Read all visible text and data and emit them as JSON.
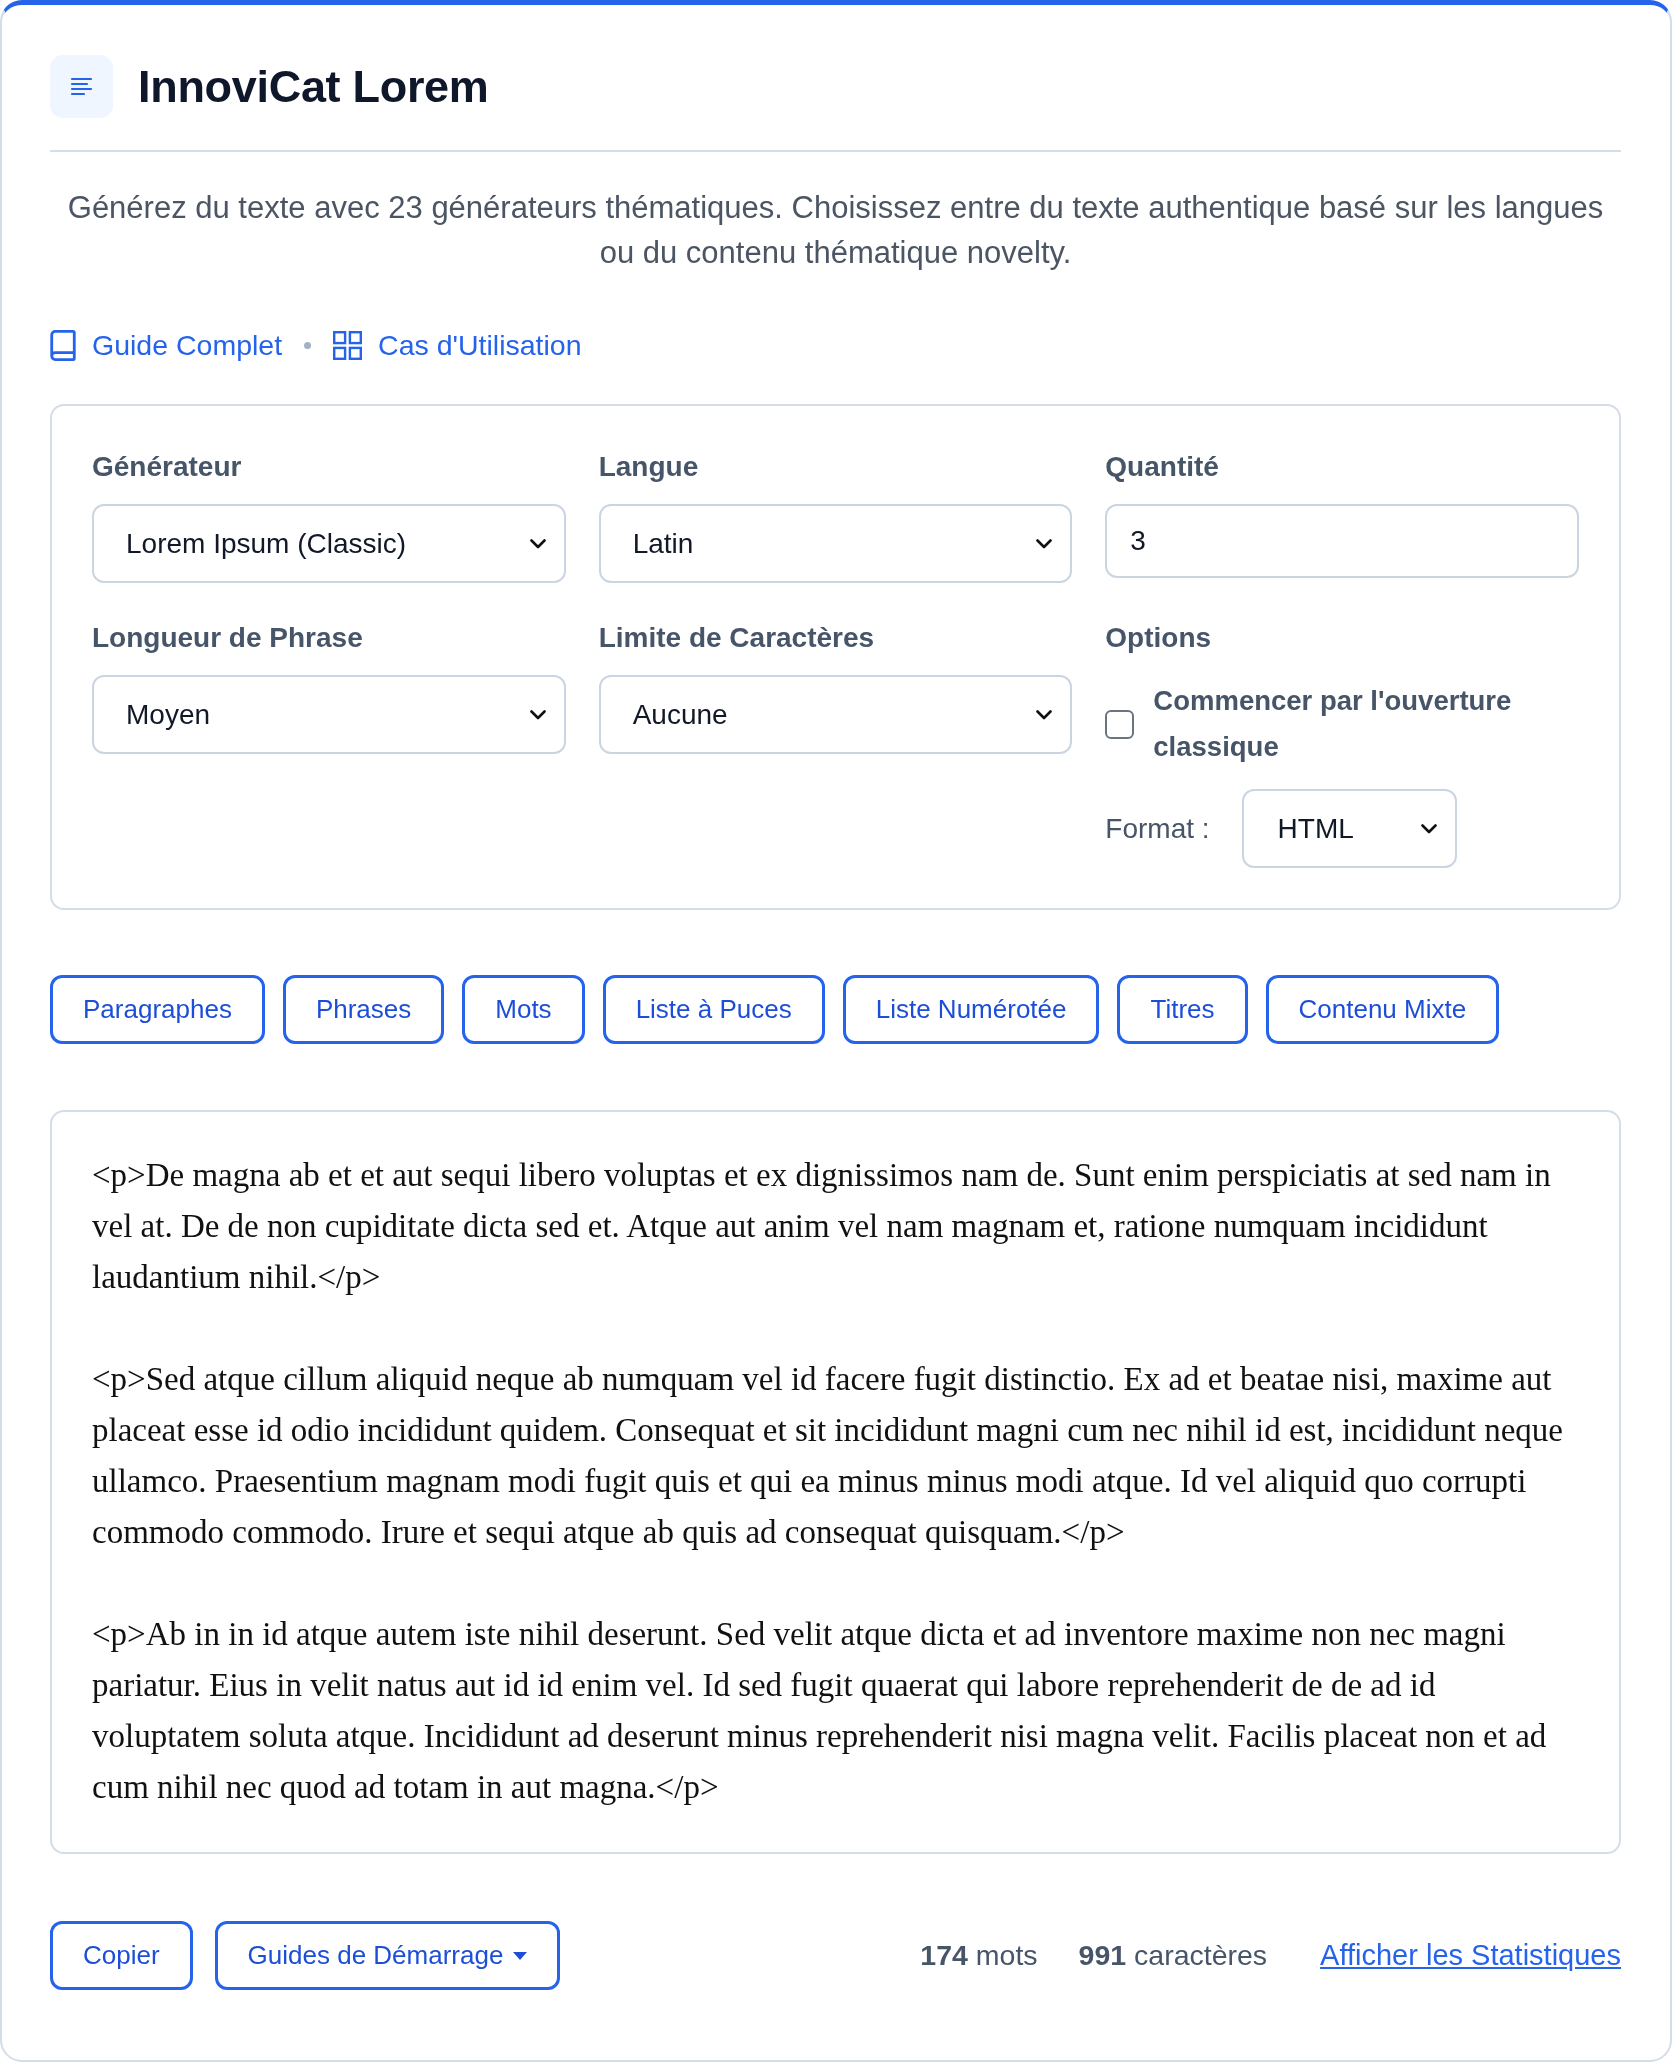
{
  "header": {
    "title": "InnoviCat Lorem"
  },
  "description": "Générez du texte avec 23 générateurs thématiques. Choisissez entre du texte authentique basé sur les langues ou du contenu thématique novelty.",
  "links": [
    {
      "label": "Guide Complet",
      "kind": "book"
    },
    {
      "label": "Cas d'Utilisation",
      "kind": "grid"
    }
  ],
  "options_panel": {
    "fields": [
      {
        "label": "Générateur",
        "kind": "select",
        "value": "Lorem Ipsum (Classic)"
      },
      {
        "label": "Langue",
        "kind": "select",
        "value": "Latin"
      },
      {
        "label": "Quantité",
        "kind": "number",
        "value": "3"
      },
      {
        "label": "Longueur de Phrase",
        "kind": "select",
        "value": "Moyen"
      },
      {
        "label": "Limite de Caractères",
        "kind": "select",
        "value": "Aucune"
      }
    ],
    "options": {
      "label": "Options",
      "checkbox": {
        "label": "Commencer par l'ouverture classique",
        "checked": false
      },
      "format": {
        "label": "Format :",
        "value": "HTML"
      }
    }
  },
  "mode_buttons": [
    "Paragraphes",
    "Phrases",
    "Mots",
    "Liste à Puces",
    "Liste Numérotée",
    "Titres",
    "Contenu Mixte"
  ],
  "output": {
    "paragraphs": [
      "<p>De magna ab et et aut sequi libero voluptas et ex dignissimos nam de. Sunt enim perspiciatis at sed nam in vel at. De de non cupiditate dicta sed et. Atque aut anim vel nam magnam et, ratione numquam incididunt laudantium nihil.</p>",
      "<p>Sed atque cillum aliquid neque ab numquam vel id facere fugit distinctio. Ex ad et beatae nisi, maxime aut placeat esse id odio incididunt quidem. Consequat et sit incididunt magni cum nec nihil id est, incididunt neque ullamco. Praesentium magnam modi fugit quis et qui ea minus minus modi atque. Id vel aliquid quo corrupti commodo commodo. Irure et sequi atque ab quis ad consequat quisquam.</p>",
      "<p>Ab in in id atque autem iste nihil deserunt. Sed velit atque dicta et ad inventore maxime non nec magni pariatur. Eius in velit natus aut id id enim vel. Id sed fugit quaerat qui labore reprehenderit de de ad id voluptatem soluta atque. Incididunt ad deserunt minus reprehenderit nisi magna velit. Facilis placeat non et ad cum nihil nec quod ad totam in aut magna.</p>"
    ]
  },
  "footer": {
    "buttons": [
      {
        "label": "Copier",
        "kind": "button"
      },
      {
        "label": "Guides de Démarrage",
        "kind": "dropdown"
      }
    ],
    "stats": [
      "**174** mots",
      "**991** caractères"
    ],
    "link": "Afficher les Statistiques"
  }
}
